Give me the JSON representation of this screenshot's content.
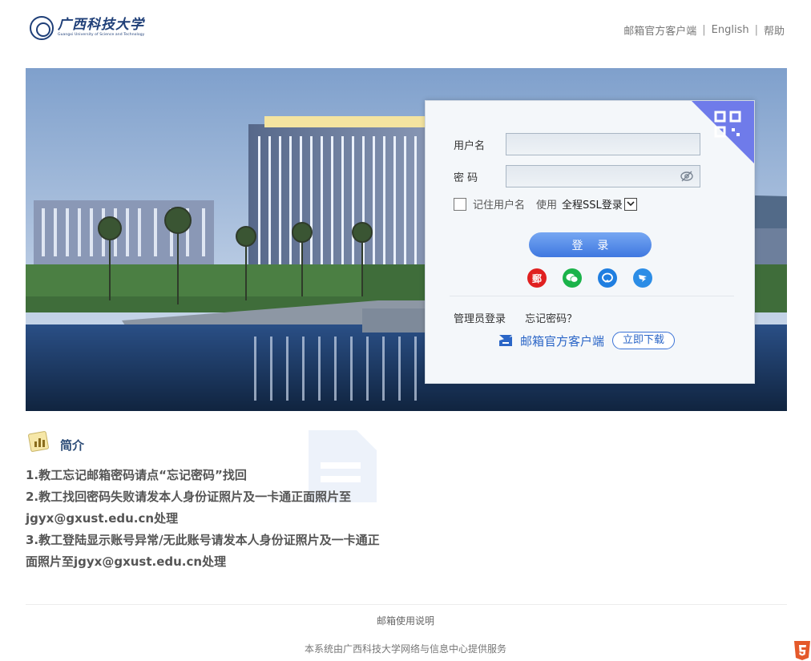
{
  "header": {
    "logo_name": "广西科技大学",
    "logo_en": "Guangxi University of Science and Technology",
    "links": [
      "邮箱官方客户端",
      "English",
      "帮助"
    ]
  },
  "login": {
    "username_label": "用户名",
    "password_label": "密 码",
    "username_value": "",
    "password_value": "",
    "remember_label": "记住用户名",
    "use_label": "使用",
    "ssl_label": "全程SSL登录",
    "submit_label": "登 录",
    "oauth": [
      {
        "name": "郵",
        "color": "#e02020"
      },
      {
        "name": "wechat-icon",
        "color": "#1bb34a"
      },
      {
        "name": "chat-icon",
        "color": "#1f7ee0"
      },
      {
        "name": "bird-icon",
        "color": "#2c8de6"
      }
    ],
    "admin_link": "管理员登录",
    "forgot_link": "忘记密码？",
    "client_text": "邮箱官方客户端",
    "download_label": "立即下载"
  },
  "intro": {
    "title": "简介",
    "lines": [
      "1.教工忘记邮箱密码请点“忘记密码”找回",
      "2.教工找回密码失败请发本人身份证照片及一卡通正面照片至jgyx@gxust.edu.cn处理",
      "3.教工登陆显示账号异常/无此账号请发本人身份证照片及一卡通正面照片至jgyx@gxust.edu.cn处理"
    ]
  },
  "footer": {
    "help_link": "邮箱使用说明",
    "service_text": "本系统由广西科技大学网络与信息中心提供服务"
  },
  "colors": {
    "brand": "#1f3f78",
    "accent": "#3f78e0",
    "qr_corner": "#6f7bea"
  }
}
